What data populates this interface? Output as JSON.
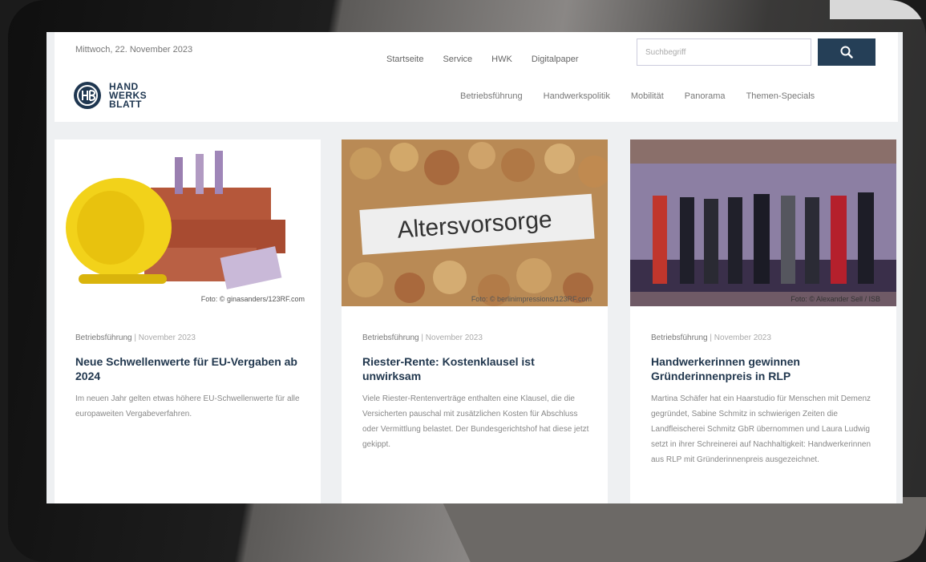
{
  "date": "Mittwoch, 22. November 2023",
  "topnav": [
    "Startseite",
    "Service",
    "HWK",
    "Digitalpaper"
  ],
  "search": {
    "placeholder": "Suchbegriff"
  },
  "logo": {
    "mark": "HB",
    "line1": "HAND",
    "line2": "WERKS",
    "line3": "BLATT"
  },
  "mainnav": [
    "Betriebsführung",
    "Handwerkspolitik",
    "Mobilität",
    "Panorama",
    "Themen-Specials"
  ],
  "articles": [
    {
      "credit": "Foto: © ginasanders/123RF.com",
      "category": "Betriebsführung",
      "month": "November 2023",
      "title": "Neue Schwellenwerte für EU-Vergaben ab 2024",
      "teaser": "Im neuen Jahr gelten etwas höhere EU-Schwellenwerte für alle europaweiten Vergabeverfahren."
    },
    {
      "credit": "Foto: © berlinimpressions/123RF.com",
      "image_text": "Altersvorsorge",
      "category": "Betriebsführung",
      "month": "November 2023",
      "title": "Riester-Rente: Kostenklausel ist unwirksam",
      "teaser": "Viele Riester-Rentenverträge enthalten eine Klausel, die die Versicherten pauschal mit zusätzlichen Kosten für Abschluss oder Vermittlung belastet. Der Bundesgerichtshof hat diese jetzt gekippt."
    },
    {
      "credit": "Foto: © Alexander Sell / ISB",
      "category": "Betriebsführung",
      "month": "November 2023",
      "title": "Handwerkerinnen gewinnen Gründerinnenpreis in RLP",
      "teaser": "Martina Schäfer hat ein Haarstudio für Menschen mit Demenz gegründet, Sabine Schmitz in schwierigen Zeiten die Landfleischerei Schmitz GbR übernommen und Laura Ludwig setzt in ihrer Schreinerei auf Nachhaltigkeit: Handwerkerinnen aus RLP mit Gründerinnenpreis ausgezeichnet."
    }
  ]
}
